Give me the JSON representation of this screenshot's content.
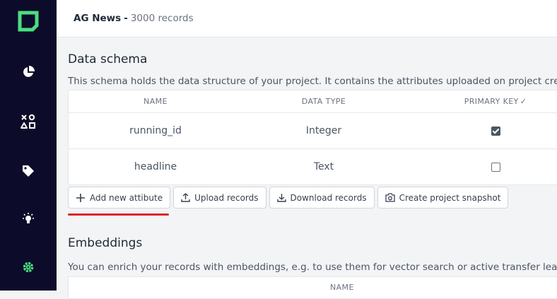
{
  "sidebar": {
    "icons": [
      "logo-icon",
      "pie-chart-icon",
      "shapes-icon",
      "tag-icon",
      "lightbulb-icon",
      "gear-icon"
    ],
    "accent_color": "#4ade80"
  },
  "header": {
    "project_name": "AG News",
    "separator": "-",
    "record_count": "3000 records"
  },
  "data_schema": {
    "title": "Data schema",
    "description": "This schema holds the data structure of your project. It contains the attributes uploaded on project creation",
    "columns": [
      "NAME",
      "DATA TYPE",
      "PRIMARY KEY"
    ],
    "rows": [
      {
        "name": "running_id",
        "data_type": "Integer",
        "primary_key": true
      },
      {
        "name": "headline",
        "data_type": "Text",
        "primary_key": false
      }
    ],
    "buttons": {
      "add_attribute": "Add new attibute",
      "upload_records": "Upload records",
      "download_records": "Download records",
      "create_snapshot": "Create project snapshot"
    },
    "highlight_color": "#dc2626"
  },
  "embeddings": {
    "title": "Embeddings",
    "description": "You can enrich your records with embeddings, e.g. to use them for vector search or active transfer learning.",
    "columns": [
      "NAME"
    ]
  }
}
